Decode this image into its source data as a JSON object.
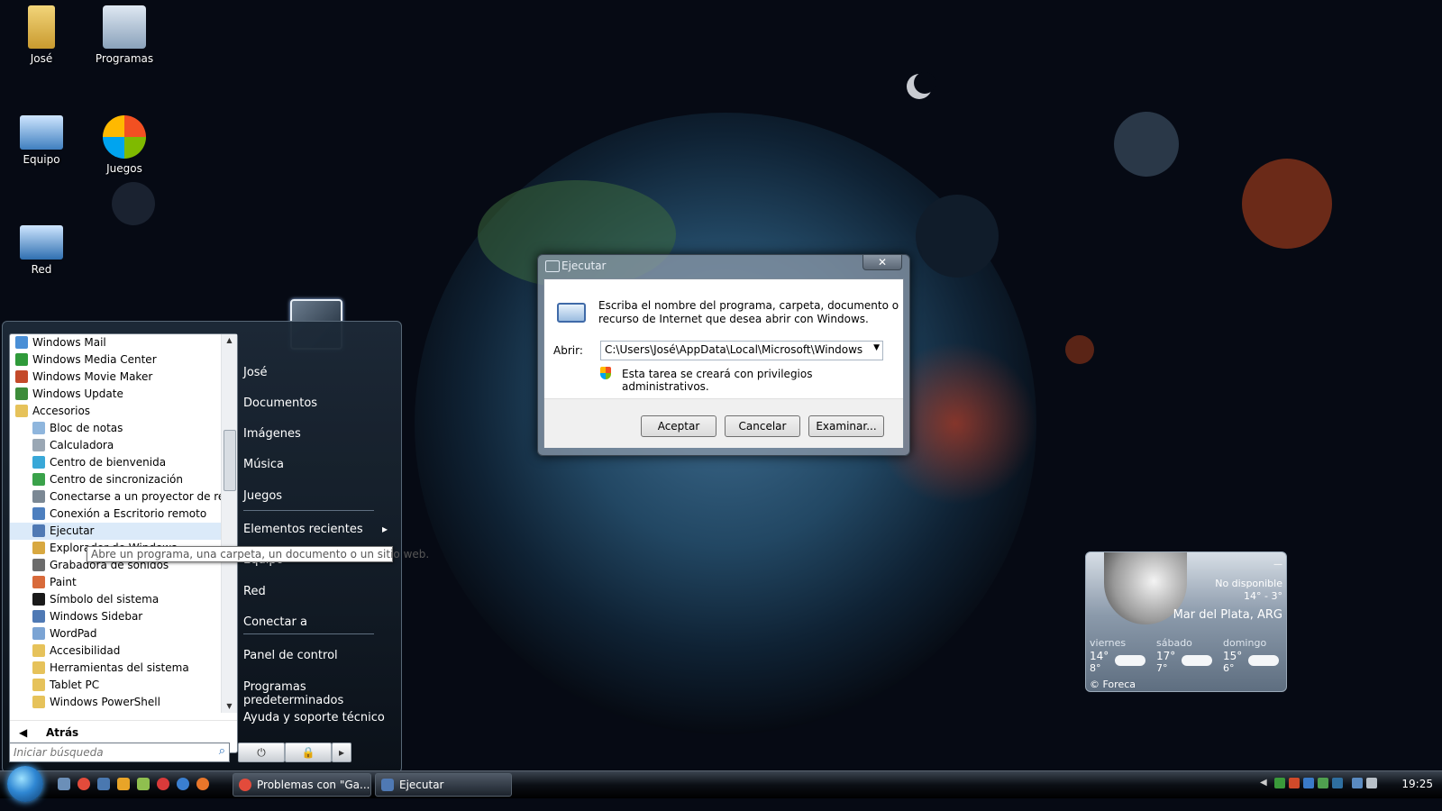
{
  "desktop": {
    "icons": [
      {
        "label": "José",
        "icon": "user-folder-icon"
      },
      {
        "label": "Programas",
        "icon": "programs-icon"
      },
      {
        "label": "Equipo",
        "icon": "computer-icon"
      },
      {
        "label": "Juegos",
        "icon": "games-icon"
      },
      {
        "label": "Red",
        "icon": "network-icon"
      }
    ]
  },
  "start_menu": {
    "programs": [
      {
        "label": "Windows Mail",
        "icon": "mail-icon",
        "color": "#4a8fd6",
        "indent": 0
      },
      {
        "label": "Windows Media Center",
        "icon": "media-center-icon",
        "color": "#2f9a3a",
        "indent": 0
      },
      {
        "label": "Windows Movie Maker",
        "icon": "movie-maker-icon",
        "color": "#c44a2a",
        "indent": 0
      },
      {
        "label": "Windows Update",
        "icon": "update-icon",
        "color": "#3d8c3a",
        "indent": 0
      },
      {
        "label": "Accesorios",
        "icon": "folder-icon",
        "color": "#e6c25a",
        "indent": 0
      },
      {
        "label": "Bloc de notas",
        "icon": "notepad-icon",
        "color": "#8fb6dd",
        "indent": 1
      },
      {
        "label": "Calculadora",
        "icon": "calculator-icon",
        "color": "#9aa7b4",
        "indent": 1
      },
      {
        "label": "Centro de bienvenida",
        "icon": "welcome-center-icon",
        "color": "#39a8d8",
        "indent": 1
      },
      {
        "label": "Centro de sincronización",
        "icon": "sync-center-icon",
        "color": "#3aa24a",
        "indent": 1
      },
      {
        "label": "Conectarse a un proyector de red",
        "icon": "projector-icon",
        "color": "#7b8894",
        "indent": 1
      },
      {
        "label": "Conexión a Escritorio remoto",
        "icon": "remote-desktop-icon",
        "color": "#4d7fbf",
        "indent": 1
      },
      {
        "label": "Ejecutar",
        "icon": "run-icon",
        "color": "#4f79b4",
        "indent": 1
      },
      {
        "label": "Explorador de Windows",
        "icon": "explorer-icon",
        "color": "#d8a840",
        "indent": 1
      },
      {
        "label": "Grabadora de sonidos",
        "icon": "sound-recorder-icon",
        "color": "#6c6c6c",
        "indent": 1
      },
      {
        "label": "Paint",
        "icon": "paint-icon",
        "color": "#d86a3a",
        "indent": 1
      },
      {
        "label": "Símbolo del sistema",
        "icon": "command-prompt-icon",
        "color": "#1a1a1a",
        "indent": 1
      },
      {
        "label": "Windows Sidebar",
        "icon": "sidebar-icon",
        "color": "#4f79b4",
        "indent": 1
      },
      {
        "label": "WordPad",
        "icon": "wordpad-icon",
        "color": "#7ba4d4",
        "indent": 1
      },
      {
        "label": "Accesibilidad",
        "icon": "folder-icon",
        "color": "#e6c25a",
        "indent": 1
      },
      {
        "label": "Herramientas del sistema",
        "icon": "folder-icon",
        "color": "#e6c25a",
        "indent": 1
      },
      {
        "label": "Tablet PC",
        "icon": "folder-icon",
        "color": "#e6c25a",
        "indent": 1
      },
      {
        "label": "Windows PowerShell",
        "icon": "folder-icon",
        "color": "#e6c25a",
        "indent": 1
      }
    ],
    "selected_index": 11,
    "back_label": "Atrás",
    "search_placeholder": "Iniciar búsqueda",
    "places": [
      "José",
      "Documentos",
      "Imágenes",
      "Música",
      "Juegos",
      "Elementos recientes",
      "Equipo",
      "Red",
      "Conectar a",
      "Panel de control",
      "Programas predeterminados",
      "Ayuda y soporte técnico"
    ],
    "tooltip": "Abre un programa, una carpeta, un documento o un sitio web."
  },
  "run_dialog": {
    "title": "Ejecutar",
    "close": "✕",
    "description_line1": "Escriba el nombre del programa, carpeta, documento o",
    "description_line2": "recurso de Internet que desea abrir con Windows.",
    "open_label": "Abrir:",
    "open_value": "C:\\Users\\José\\AppData\\Local\\Microsoft\\Windows Live\\",
    "admin_note": "Esta tarea se creará con privilegios administrativos.",
    "ok_label": "Aceptar",
    "cancel_label": "Cancelar",
    "browse_label": "Examinar..."
  },
  "weather": {
    "status": "No disponible",
    "high_low": "14° - 3°",
    "location": "Mar del Plata, ARG",
    "days": [
      {
        "name": "viernes",
        "high": "14°",
        "low": "8°"
      },
      {
        "name": "sábado",
        "high": "17°",
        "low": "7°"
      },
      {
        "name": "domingo",
        "high": "15°",
        "low": "6°"
      }
    ],
    "credit": "© Foreca"
  },
  "taskbar": {
    "buttons": [
      {
        "label": "Problemas con \"Ga...",
        "icon": "chrome-icon",
        "color": "#e34b3b"
      },
      {
        "label": "Ejecutar",
        "icon": "run-icon",
        "color": "#4f79b4"
      }
    ],
    "clock": "19:25"
  }
}
